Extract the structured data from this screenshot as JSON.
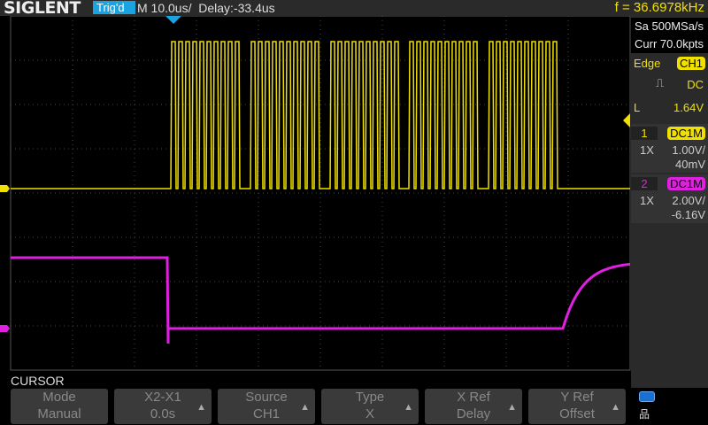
{
  "header": {
    "brand": "SIGLENT",
    "trigger_status": "Trig'd",
    "timebase": "M 10.0us/",
    "delay": "Delay:-33.4us",
    "frequency": "f = 36.6978kHz"
  },
  "acquisition": {
    "sample_rate": "Sa 500MSa/s",
    "memory": "Curr 70.0kpts"
  },
  "trigger": {
    "type": "Edge",
    "source": "CH1",
    "coupling": "DC",
    "level_label": "L",
    "level": "1.64V"
  },
  "channels": [
    {
      "num": "1",
      "coupling": "DC1M",
      "probe": "1X",
      "scale": "1.00V/",
      "offset": "40mV",
      "color": "#f0e000"
    },
    {
      "num": "2",
      "coupling": "DC1M",
      "probe": "1X",
      "scale": "2.00V/",
      "offset": "-6.16V",
      "color": "#e020e0"
    }
  ],
  "menu": {
    "title": "CURSOR",
    "buttons": [
      {
        "label": "Mode",
        "value": "Manual"
      },
      {
        "label": "X2-X1",
        "value": "0.0s"
      },
      {
        "label": "Source",
        "value": "CH1"
      },
      {
        "label": "Type",
        "value": "X"
      },
      {
        "label": "X Ref",
        "value": "Delay"
      },
      {
        "label": "Y Ref",
        "value": "Offset"
      }
    ]
  }
}
